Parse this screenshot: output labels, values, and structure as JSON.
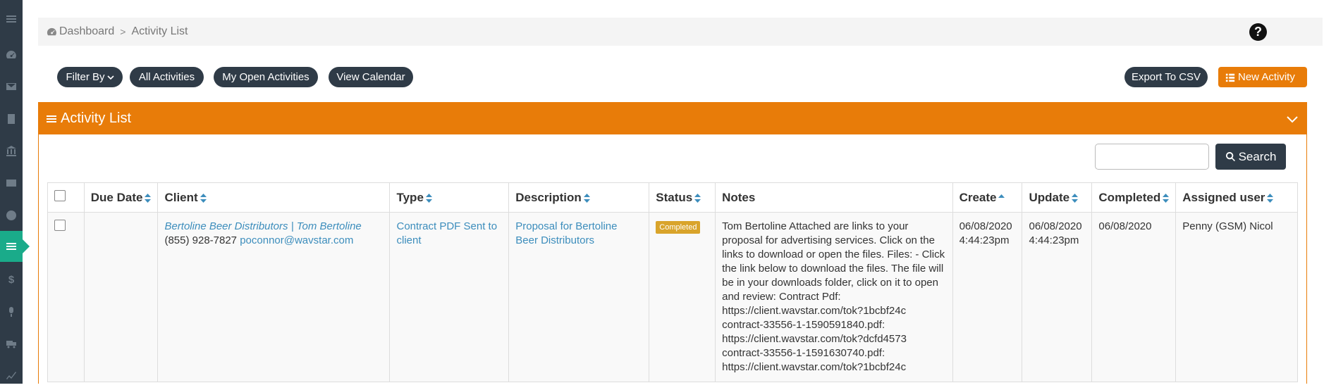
{
  "breadcrumb": {
    "home": "Dashboard",
    "separator": ">",
    "current": "Activity List"
  },
  "toolbar": {
    "filter_by": "Filter By",
    "all_activities": "All Activities",
    "my_open_activities": "My Open Activities",
    "view_calendar": "View Calendar",
    "export_csv": "Export To CSV",
    "new_activity": "New Activity"
  },
  "panel": {
    "title": "Activity List"
  },
  "search": {
    "button": "Search",
    "value": ""
  },
  "table": {
    "headers": [
      "Due Date",
      "Client",
      "Type",
      "Description",
      "Status",
      "Notes",
      "Create",
      "Update",
      "Completed",
      "Assigned user"
    ],
    "rows": [
      {
        "due_date": "",
        "client_name": "Bertoline Beer Distributors | Tom Bertoline",
        "client_phone": "(855) 928-7827",
        "client_email": "poconnor@wavstar.com",
        "type": "Contract PDF Sent to client",
        "description": "Proposal for Bertoline Beer Distributors",
        "status": "Completed",
        "notes": "Tom Bertoline Attached are links to your proposal for advertising services. Click on the links to download or open the files. Files: - Click the link below to download the files. The file will be in your downloads folder, click on it to open and review: Contract Pdf: https://client.wavstar.com/tok?1bcbf24c contract-33556-1-1590591840.pdf: https://client.wavstar.com/tok?dcfd4573 contract-33556-1-1591630740.pdf: https://client.wavstar.com/tok?1bcbf24c",
        "create_date": "06/08/2020",
        "create_time": "4:44:23pm",
        "update_date": "06/08/2020",
        "update_time": "4:44:23pm",
        "completed": "06/08/2020",
        "assigned_user": "Penny (GSM) Nicol"
      }
    ]
  },
  "colors": {
    "accent": "#e87c09",
    "dark": "#2f3b47",
    "sidebar_active": "#1aab8a",
    "link": "#3c8dbc",
    "badge": "#d9a42b"
  },
  "icons": [
    "menu-icon",
    "dashboard-icon",
    "envelope-icon",
    "building-icon",
    "bank-icon",
    "id-card-icon",
    "user-circle-icon",
    "list-icon",
    "dollar-icon",
    "microphone-icon",
    "truck-icon",
    "chart-line-icon",
    "help-icon",
    "chevron-down-icon",
    "search-icon"
  ]
}
